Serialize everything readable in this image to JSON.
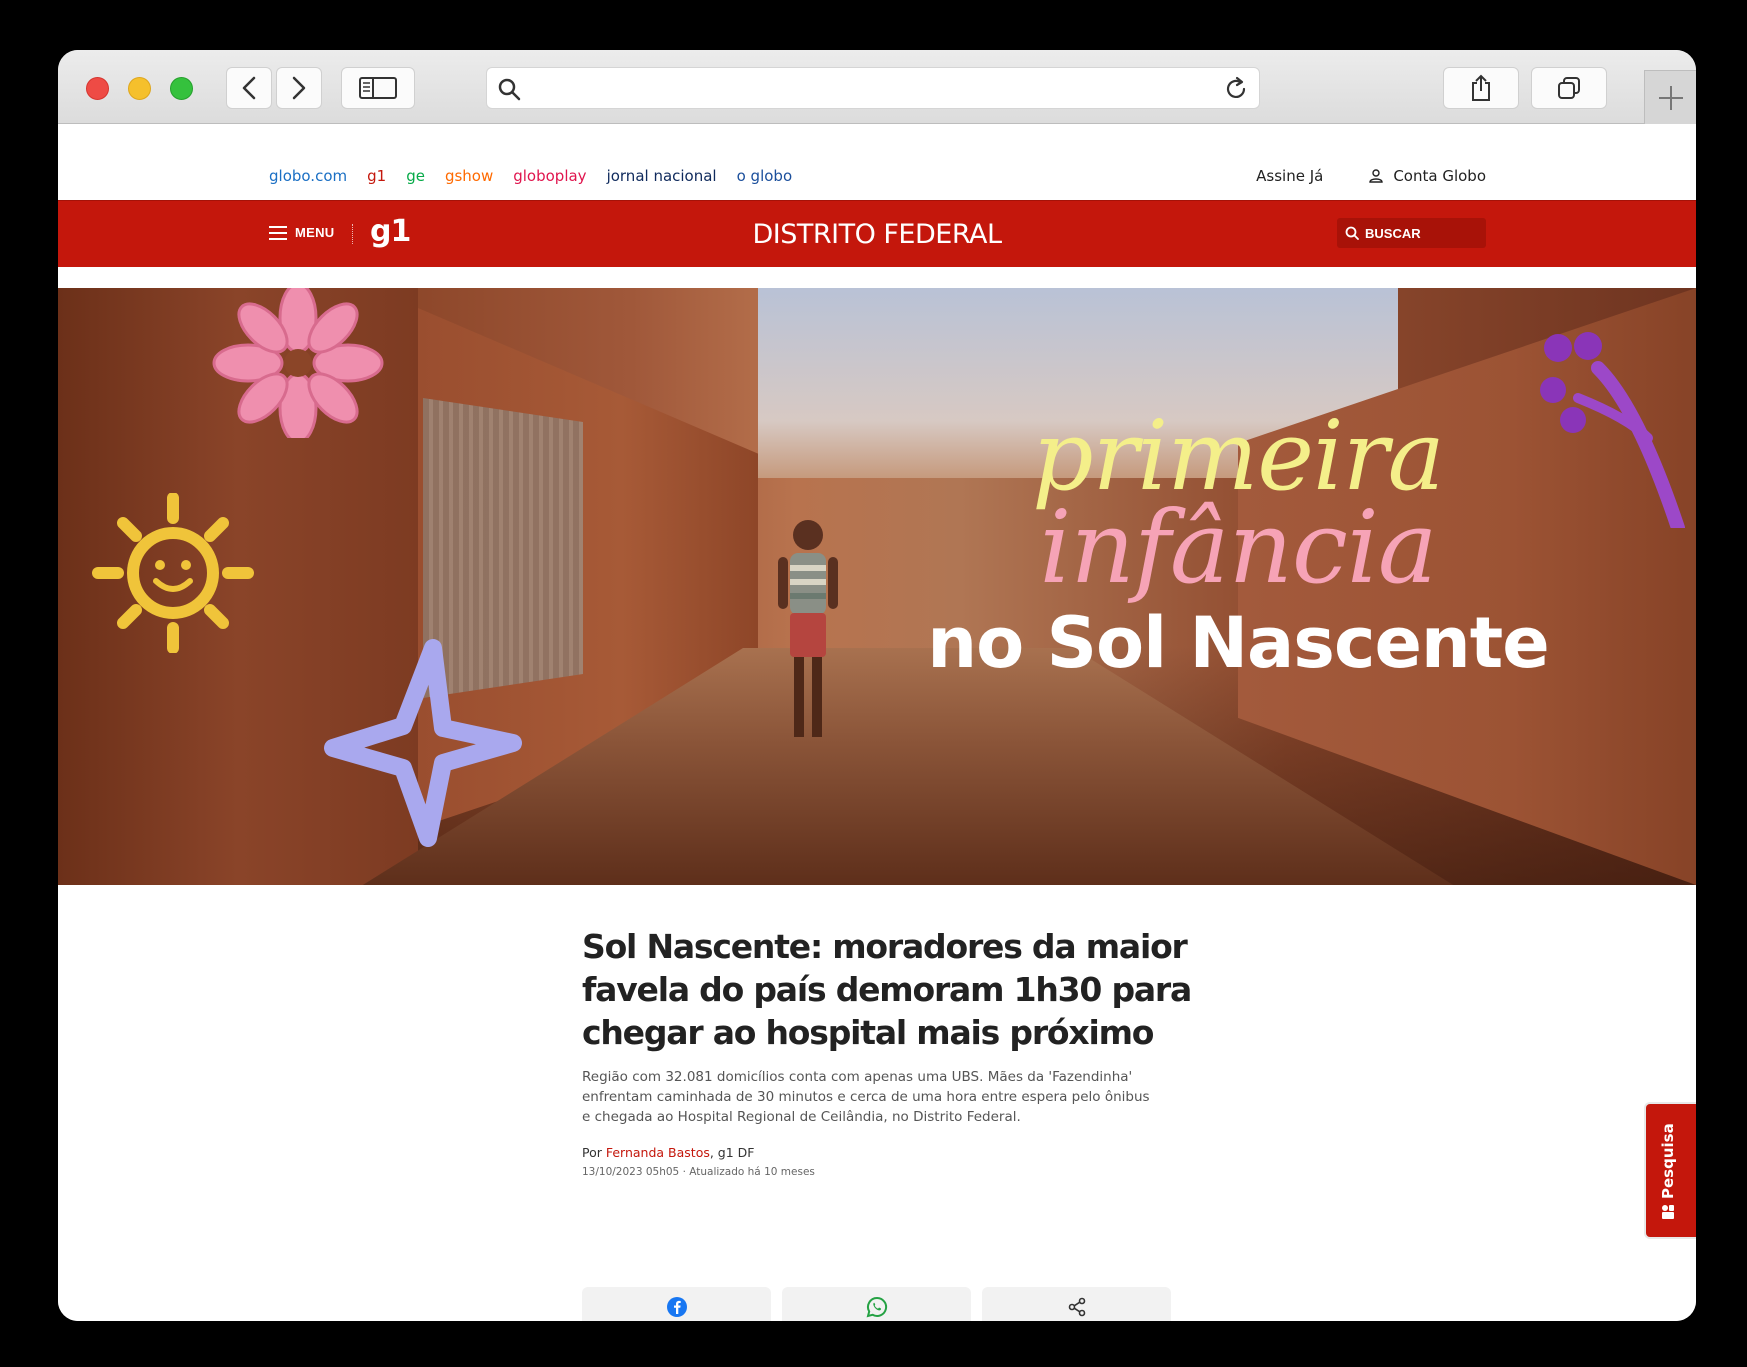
{
  "browser": {
    "url": ""
  },
  "topnav": {
    "links": [
      {
        "label": "globo.com",
        "color": "#1a6fc4"
      },
      {
        "label": "g1",
        "color": "#c4170c"
      },
      {
        "label": "ge",
        "color": "#06aa48"
      },
      {
        "label": "gshow",
        "color": "#ff6a00"
      },
      {
        "label": "globoplay",
        "color": "#e0154e"
      },
      {
        "label": "jornal nacional",
        "color": "#0f2a5c"
      },
      {
        "label": "o globo",
        "color": "#1b4f9c"
      }
    ],
    "assine": "Assine Já",
    "conta": "Conta Globo"
  },
  "header": {
    "menu_label": "MENU",
    "logo": "g1",
    "section": "DISTRITO FEDERAL",
    "search_label": "BUSCAR",
    "accent": "#c4170c"
  },
  "hero": {
    "line1": "primeira",
    "line2": "infância",
    "line3": "no Sol Nascente"
  },
  "article": {
    "title": "Sol Nascente: moradores da maior favela do país demoram 1h30 para chegar ao hospital mais próximo",
    "subtitle": "Região com 32.081 domicílios conta com apenas uma UBS. Mães da 'Fazendinha' enfrentam caminhada de 30 minutos e cerca de uma hora entre espera pelo ônibus e chegada ao Hospital Regional de Ceilândia, no Distrito Federal.",
    "byline_prefix": "Por ",
    "author": "Fernanda Bastos",
    "byline_suffix": ", g1 DF",
    "dates": "13/10/2023 05h05 · Atualizado há 10 meses"
  },
  "share": {
    "facebook_icon": "facebook-icon",
    "whatsapp_icon": "whatsapp-icon",
    "share_icon": "share-icon"
  },
  "survey_tab": {
    "label": "Pesquisa"
  }
}
